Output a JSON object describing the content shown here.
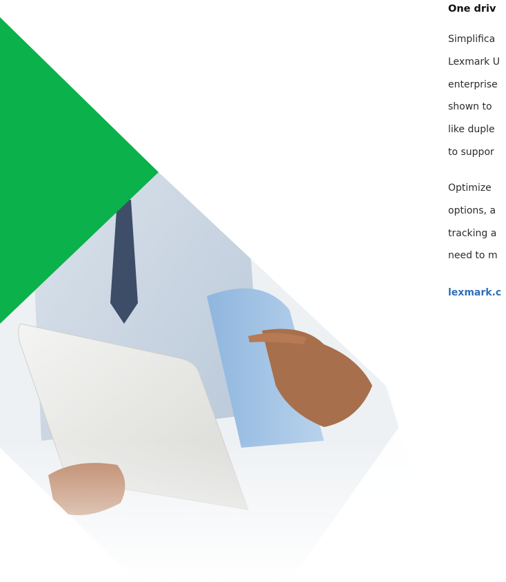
{
  "article": {
    "heading": "One driv",
    "paragraph1": [
      "Simplifica",
      "Lexmark U",
      "enterprise",
      "shown to",
      "like duple",
      "to suppor"
    ],
    "paragraph2": [
      "Optimize",
      "options, a",
      "tracking a",
      "need to m"
    ],
    "link": "lexmark.c"
  },
  "colors": {
    "accent_green": "#0bb14a",
    "link_blue": "#2f6fb5",
    "text": "#2b2b2b"
  }
}
